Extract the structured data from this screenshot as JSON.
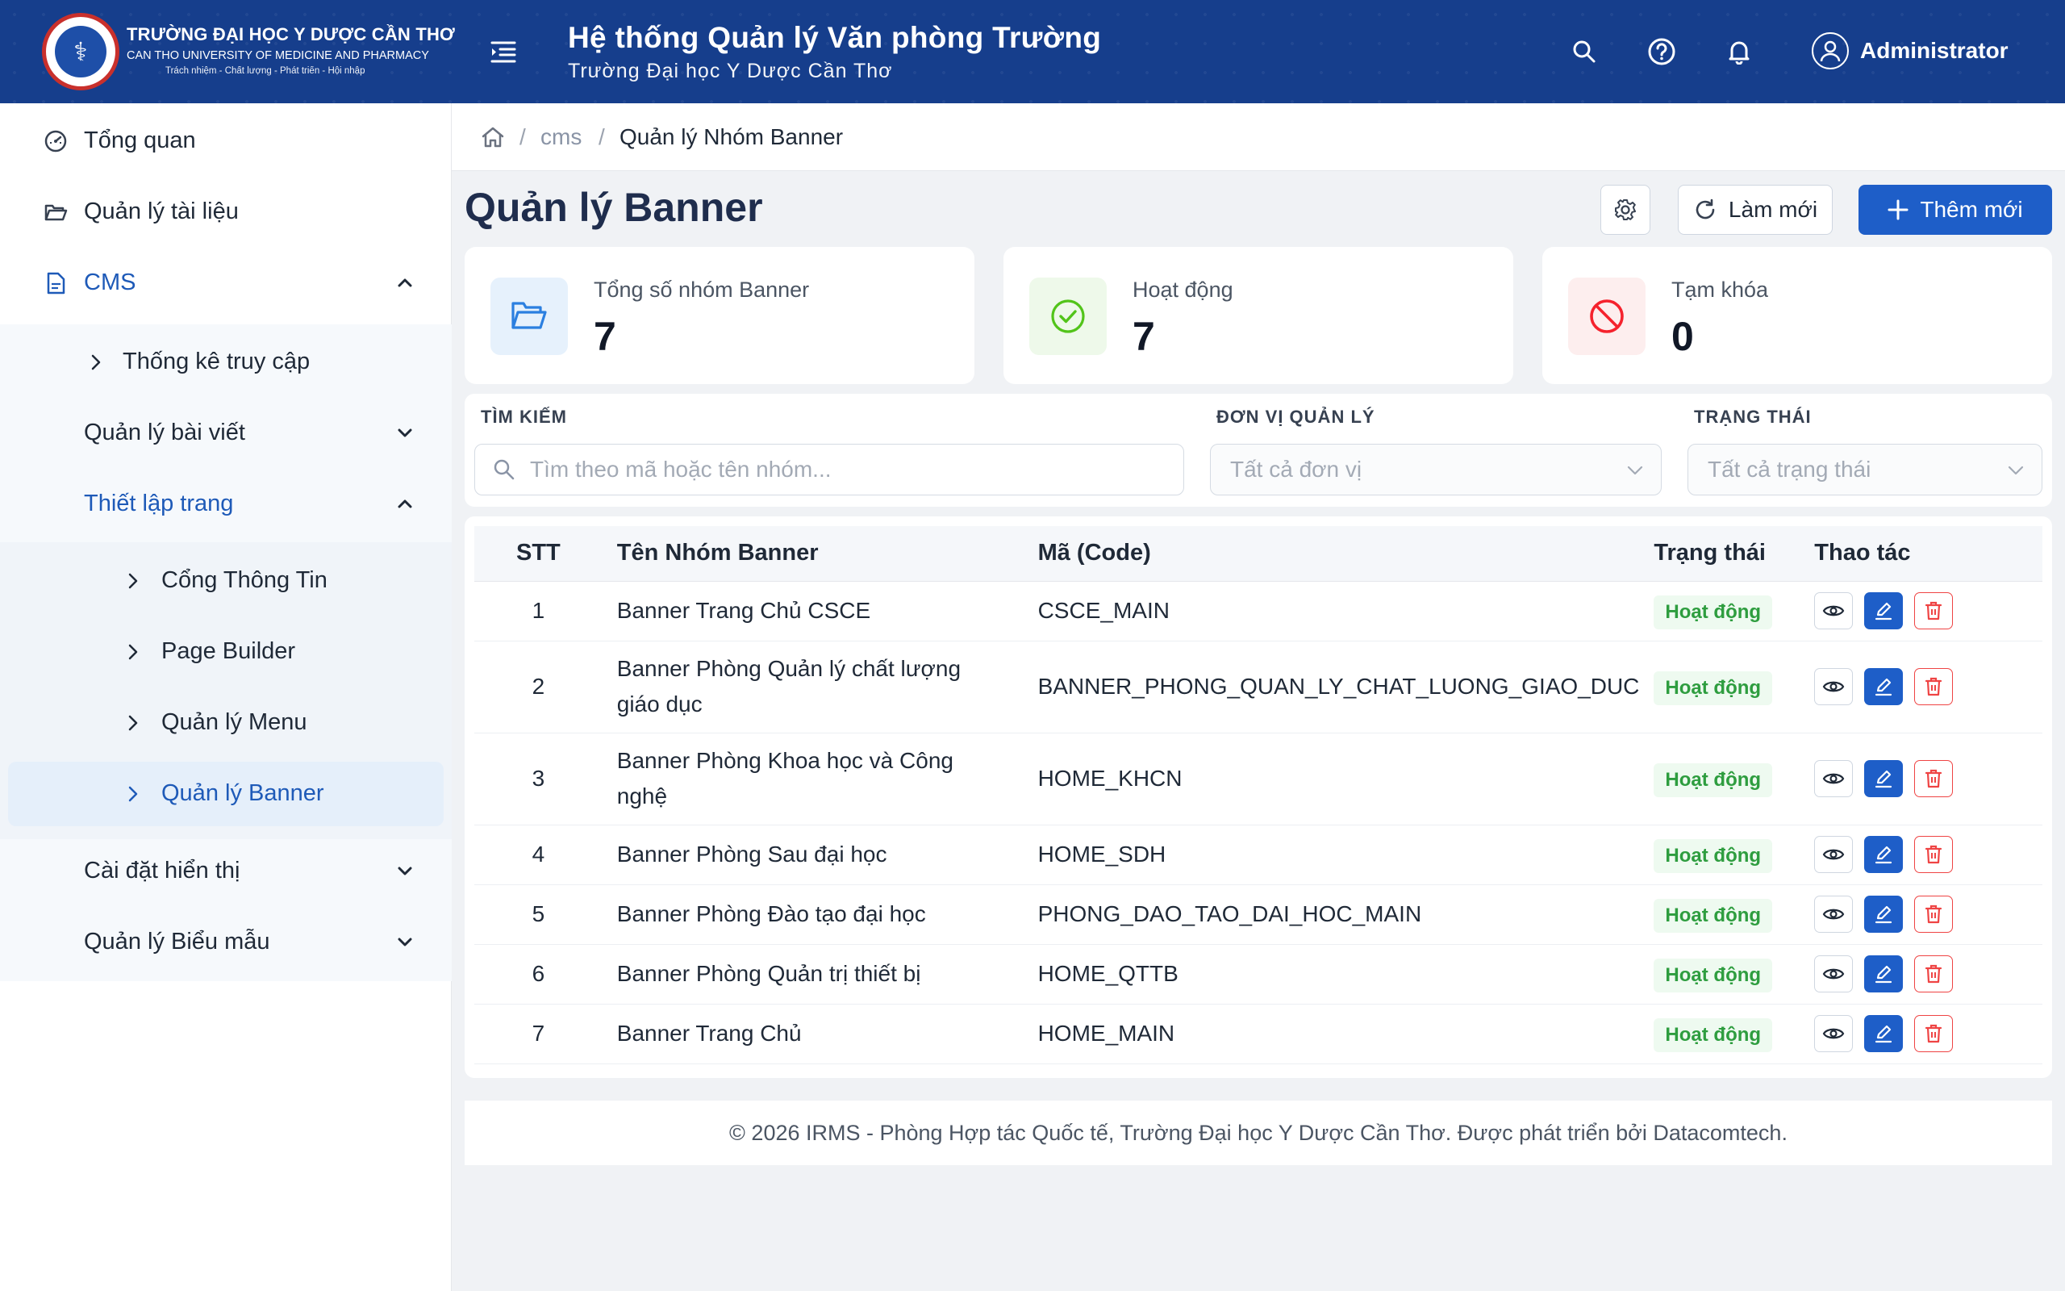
{
  "header": {
    "university_name": "TRƯỜNG ĐẠI HỌC Y DƯỢC CẦN THƠ",
    "university_en": "CAN THO UNIVERSITY OF MEDICINE AND PHARMACY",
    "motto": "Trách nhiệm - Chất lượng - Phát triển - Hội nhập",
    "app_title": "Hệ thống Quản lý Văn phòng Trường",
    "app_subtitle": "Trường Đại học Y Dược Cần Thơ",
    "user_name": "Administrator"
  },
  "sidebar": {
    "overview": "Tổng quan",
    "documents": "Quản lý tài liệu",
    "cms": "CMS",
    "access_stats": "Thống kê truy cập",
    "articles": "Quản lý bài viết",
    "page_setup": "Thiết lập trang",
    "portal": "Cổng Thông Tin",
    "page_builder": "Page Builder",
    "menu": "Quản lý Menu",
    "banner": "Quản lý Banner",
    "display_settings": "Cài đặt hiển thị",
    "forms": "Quản lý Biểu mẫu"
  },
  "breadcrumb": {
    "sep": "/",
    "cms": "cms",
    "current": "Quản lý Nhóm Banner"
  },
  "page": {
    "title": "Quản lý Banner",
    "refresh_label": "Làm mới",
    "add_label": "Thêm mới"
  },
  "stats": {
    "total_label": "Tổng số nhóm Banner",
    "total_value": "7",
    "active_label": "Hoạt động",
    "active_value": "7",
    "locked_label": "Tạm khóa",
    "locked_value": "0"
  },
  "filters": {
    "search_label": "TÌM KIẾM",
    "search_placeholder": "Tìm theo mã hoặc tên nhóm...",
    "unit_label": "ĐƠN VỊ QUẢN LÝ",
    "unit_value": "Tất cả đơn vị",
    "status_label": "TRẠNG THÁI",
    "status_value": "Tất cả trạng thái"
  },
  "table": {
    "headers": {
      "stt": "STT",
      "name": "Tên Nhóm Banner",
      "code": "Mã (Code)",
      "status": "Trạng thái",
      "actions": "Thao tác"
    },
    "rows": [
      {
        "stt": "1",
        "name": "Banner Trang Chủ CSCE",
        "code": "CSCE_MAIN",
        "status": "Hoạt động"
      },
      {
        "stt": "2",
        "name": "Banner Phòng Quản lý chất lượng giáo dục",
        "code": "BANNER_PHONG_QUAN_LY_CHAT_LUONG_GIAO_DUC",
        "status": "Hoạt động"
      },
      {
        "stt": "3",
        "name": "Banner Phòng Khoa học và Công nghệ",
        "code": "HOME_KHCN",
        "status": "Hoạt động"
      },
      {
        "stt": "4",
        "name": "Banner Phòng Sau đại học",
        "code": "HOME_SDH",
        "status": "Hoạt động"
      },
      {
        "stt": "5",
        "name": "Banner Phòng Đào tạo đại học",
        "code": "PHONG_DAO_TAO_DAI_HOC_MAIN",
        "status": "Hoạt động"
      },
      {
        "stt": "6",
        "name": "Banner Phòng Quản trị thiết bị",
        "code": "HOME_QTTB",
        "status": "Hoạt động"
      },
      {
        "stt": "7",
        "name": "Banner Trang Chủ",
        "code": "HOME_MAIN",
        "status": "Hoạt động"
      }
    ]
  },
  "footer": {
    "text": "© 2026 IRMS - Phòng Hợp tác Quốc tế, Trường Đại học Y Dược Cần Thơ. Được phát triển bởi Datacomtech."
  },
  "colors": {
    "header_bg": "#163e8c",
    "primary": "#1e5ec8",
    "active_text": "#1e5ab8",
    "success": "#2e9d3f",
    "danger": "#ef4444"
  }
}
